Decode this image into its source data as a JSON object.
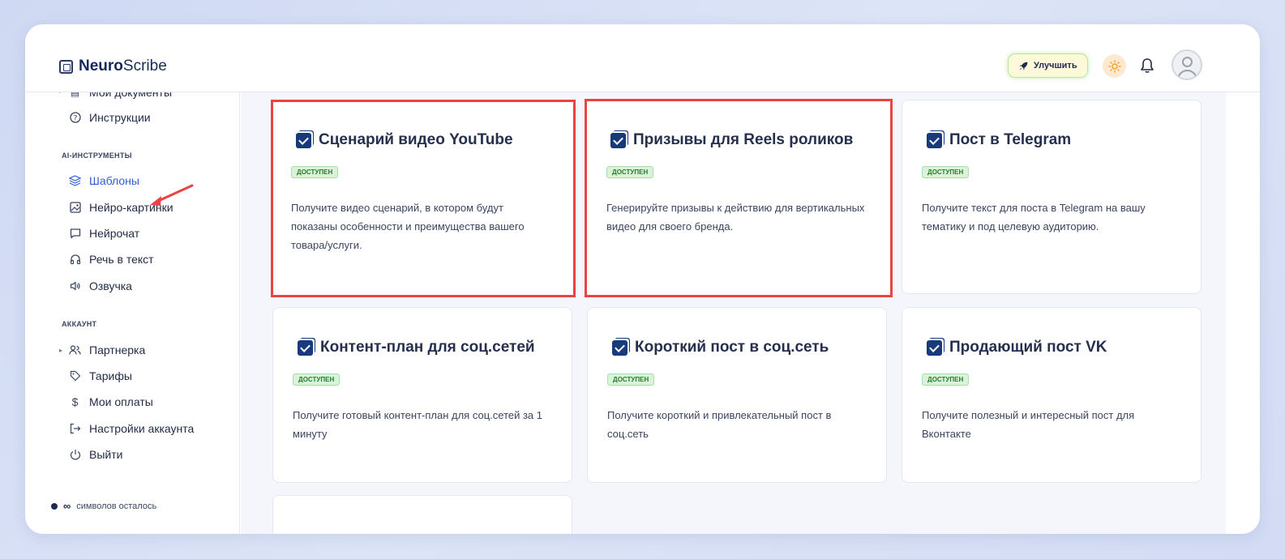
{
  "header": {
    "logo_bold": "Neuro",
    "logo_light": "Scribe",
    "upgrade_label": "Улучшить"
  },
  "sidebar": {
    "partial_item": "Мои документы",
    "instructions": "Инструкции",
    "section_ai": "AI-ИНСТРУМЕНТЫ",
    "ai_items": [
      {
        "label": "Шаблоны",
        "icon": "layers-icon"
      },
      {
        "label": "Нейро-картинки",
        "icon": "image-icon"
      },
      {
        "label": "Нейрочат",
        "icon": "chat-icon"
      },
      {
        "label": "Речь в текст",
        "icon": "headphones-icon"
      },
      {
        "label": "Озвучка",
        "icon": "speaker-icon"
      }
    ],
    "section_account": "АККАУНТ",
    "account_items": [
      {
        "label": "Партнерка",
        "icon": "users-icon"
      },
      {
        "label": "Тарифы",
        "icon": "tag-icon"
      },
      {
        "label": "Мои оплаты",
        "icon": "dollar-icon"
      },
      {
        "label": "Настройки аккаунта",
        "icon": "logout-arrow-icon"
      },
      {
        "label": "Выйти",
        "icon": "power-icon"
      }
    ],
    "symbols_value": "∞",
    "symbols_label": "символов осталось"
  },
  "cards": [
    {
      "title": "Сценарий видео YouTube",
      "badge": "ДОСТУПЕН",
      "desc": "Получите видео сценарий, в котором будут показаны особенности и преимущества вашего товара/услуги."
    },
    {
      "title": "Призывы для Reels роликов",
      "badge": "ДОСТУПЕН",
      "desc": "Генерируйте призывы к действию для вертикальных видео для своего бренда."
    },
    {
      "title": "Пост в Telegram",
      "badge": "ДОСТУПЕН",
      "desc": "Получите текст для поста в Telegram на вашу тематику и под целевую аудиторию."
    },
    {
      "title": "Контент-план для соц.сетей",
      "badge": "ДОСТУПЕН",
      "desc": "Получите готовый контент-план для соц.сетей за 1 минуту"
    },
    {
      "title": "Короткий пост в соц.сеть",
      "badge": "ДОСТУПЕН",
      "desc": "Получите короткий и привлекательный пост в соц.сеть"
    },
    {
      "title": "Продающий пост VK",
      "badge": "ДОСТУПЕН",
      "desc": "Получите полезный и интересный пост для Вконтакте"
    }
  ],
  "colors": {
    "highlight_border": "#ea4343",
    "active_nav": "#2f5fd0",
    "badge_bg": "#d9f3d9"
  }
}
